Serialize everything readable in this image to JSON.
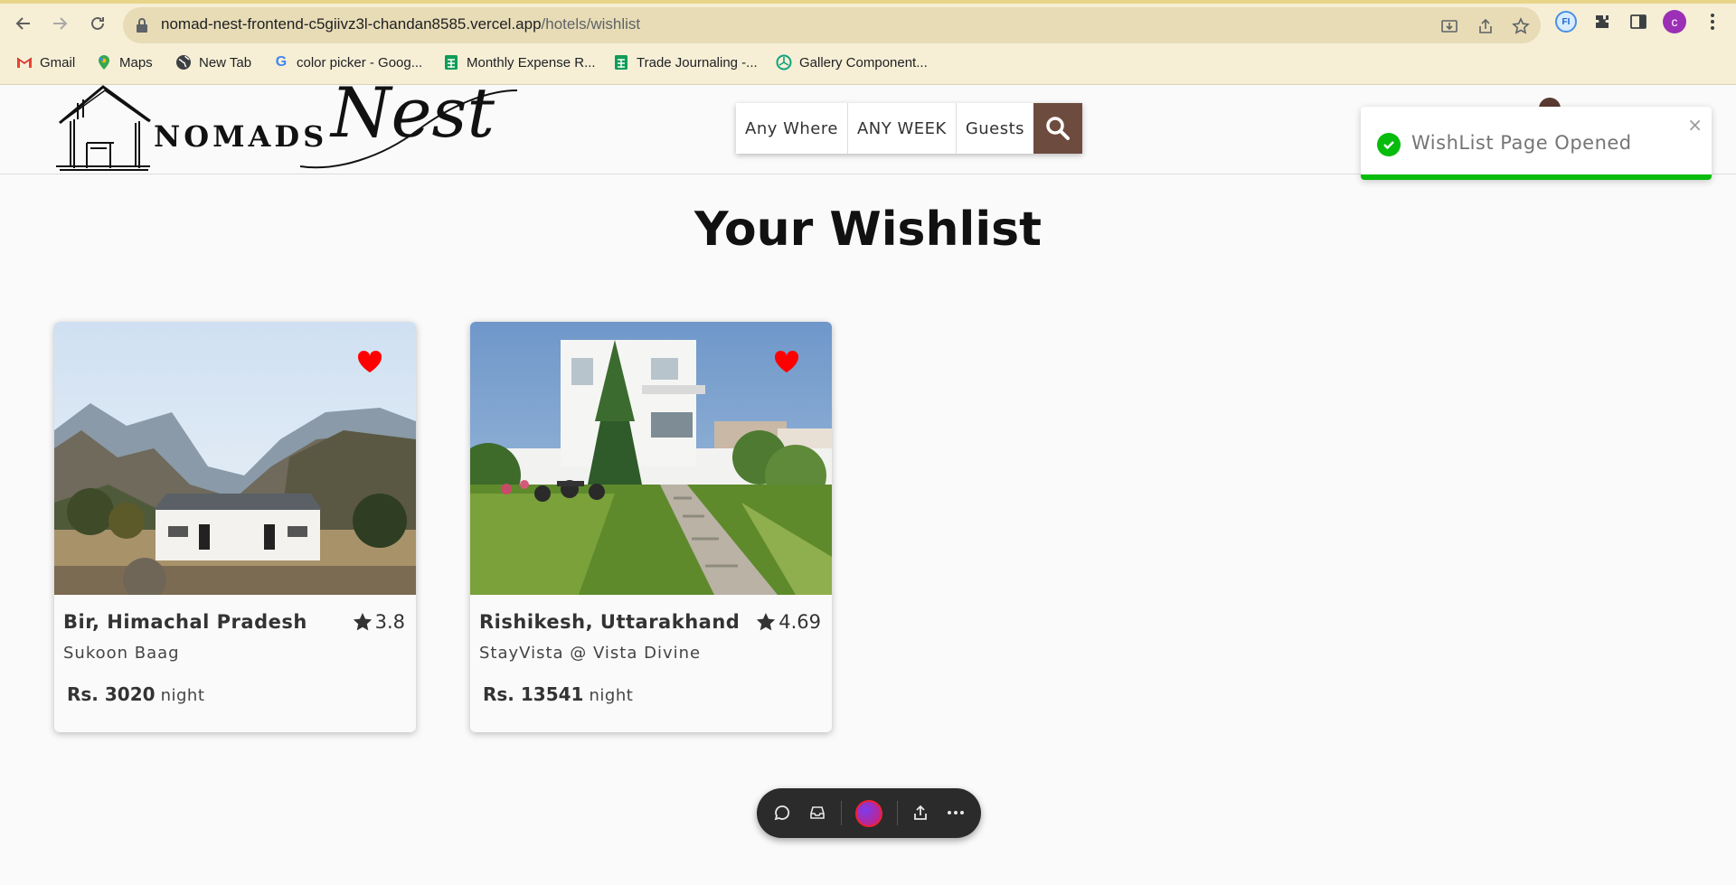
{
  "browser": {
    "url_host": "nomad-nest-frontend-c5giivz3l-chandan8585.vercel.app",
    "url_path": "/hotels/wishlist",
    "profile_initial": "c",
    "extension_label": "FI",
    "bookmarks": [
      {
        "label": "Gmail",
        "icon": "gmail-icon"
      },
      {
        "label": "Maps",
        "icon": "maps-icon"
      },
      {
        "label": "New Tab",
        "icon": "globe-icon"
      },
      {
        "label": "color picker - Goog...",
        "icon": "google-icon"
      },
      {
        "label": "Monthly Expense R...",
        "icon": "sheets-icon"
      },
      {
        "label": "Trade Journaling -...",
        "icon": "sheets-icon"
      },
      {
        "label": "Gallery Component...",
        "icon": "openai-icon"
      }
    ]
  },
  "header": {
    "logo_word": "NOMADS",
    "logo_script": "Nest",
    "search": {
      "where": "Any Where",
      "week": "ANY WEEK",
      "guests": "Guests"
    }
  },
  "toast": {
    "message": "WishList Page Opened",
    "close": "×",
    "color": "#07bc0c"
  },
  "main": {
    "title": "Your Wishlist",
    "cards": [
      {
        "location": "Bir, Himachal Pradesh",
        "rating": "3.8",
        "name": "Sukoon Baag",
        "price": "Rs. 3020",
        "unit": "night",
        "wishlisted": true
      },
      {
        "location": "Rishikesh, Uttarakhand",
        "rating": "4.69",
        "name": "StayVista @ Vista Divine",
        "price": "Rs. 13541",
        "unit": "night",
        "wishlisted": true
      }
    ]
  },
  "colors": {
    "accent_brown": "#6e4b3f",
    "heart_red": "#ff0000",
    "toast_green": "#07bc0c"
  }
}
